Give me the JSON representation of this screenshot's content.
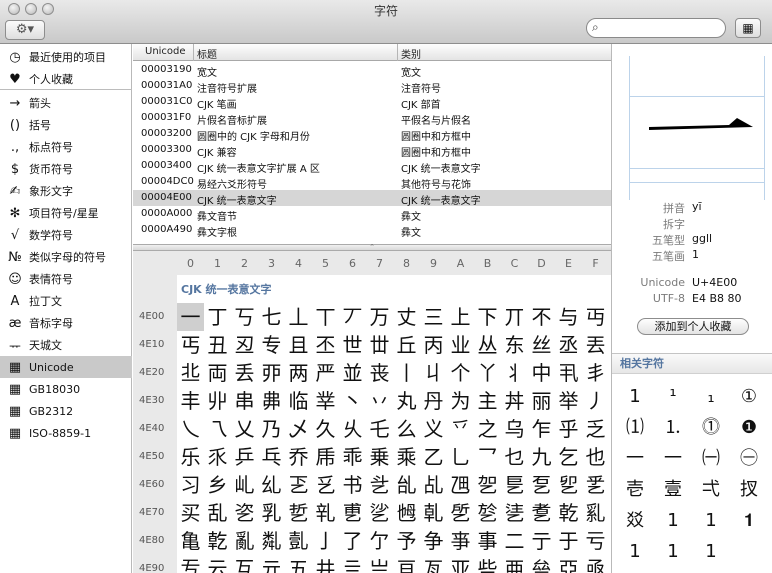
{
  "window": {
    "title": "字符"
  },
  "toolbar": {
    "gear": "⚙▾",
    "search_placeholder": "",
    "right_icon": "▦"
  },
  "sidebar": {
    "items": [
      {
        "icon": "◷",
        "label": "最近使用的项目"
      },
      {
        "icon": "♥",
        "label": "个人收藏"
      },
      {
        "icon": "→",
        "label": "箭头"
      },
      {
        "icon": "()",
        "label": "括号"
      },
      {
        "icon": ".,",
        "label": "标点符号"
      },
      {
        "icon": "$",
        "label": "货币符号"
      },
      {
        "icon": "✍",
        "label": "象形文字"
      },
      {
        "icon": "✻",
        "label": "项目符号/星星"
      },
      {
        "icon": "√",
        "label": "数学符号"
      },
      {
        "icon": "№",
        "label": "类似字母的符号"
      },
      {
        "icon": "☺",
        "label": "表情符号"
      },
      {
        "icon": "A",
        "label": "拉丁文"
      },
      {
        "icon": "æ",
        "label": "音标字母"
      },
      {
        "icon": "ᅲ",
        "label": "天城文"
      },
      {
        "icon": "▦",
        "label": "Unicode",
        "selected": true
      },
      {
        "icon": "▦",
        "label": "GB18030"
      },
      {
        "icon": "▦",
        "label": "GB2312"
      },
      {
        "icon": "▦",
        "label": "ISO-8859-1"
      }
    ]
  },
  "table": {
    "headers": [
      "Unicode",
      "标题",
      "类别"
    ],
    "rows": [
      [
        "00003190",
        "宽文",
        "宽文"
      ],
      [
        "000031A0",
        "注音符号扩展",
        "注音符号"
      ],
      [
        "000031C0",
        "CJK 笔画",
        "CJK 部首"
      ],
      [
        "000031F0",
        "片假名音标扩展",
        "平假名与片假名"
      ],
      [
        "00003200",
        "圆圈中的 CJK 字母和月份",
        "圆圈中和方框中"
      ],
      [
        "00003300",
        "CJK 兼容",
        "圆圈中和方框中"
      ],
      [
        "00003400",
        "CJK 统一表意文字扩展 A 区",
        "CJK 统一表意文字"
      ],
      [
        "00004DC0",
        "易经六爻形符号",
        "其他符号与花饰"
      ],
      [
        "00004E00",
        "CJK 统一表意文字",
        "CJK 统一表意文字"
      ],
      [
        "0000A000",
        "彝文音节",
        "彝文"
      ],
      [
        "0000A490",
        "彝文字根",
        "彝文"
      ]
    ],
    "selected_row": 8
  },
  "grid": {
    "block_name": "CJK 统一表意文字",
    "columns": [
      "0",
      "1",
      "2",
      "3",
      "4",
      "5",
      "6",
      "7",
      "8",
      "9",
      "A",
      "B",
      "C",
      "D",
      "E",
      "F"
    ],
    "rows": [
      {
        "label": "4E00",
        "chars": [
          "一",
          "丁",
          "丂",
          "七",
          "丄",
          "丅",
          "丆",
          "万",
          "丈",
          "三",
          "上",
          "下",
          "丌",
          "不",
          "与",
          "丏"
        ]
      },
      {
        "label": "4E10",
        "chars": [
          "丐",
          "丑",
          "丒",
          "专",
          "且",
          "丕",
          "世",
          "丗",
          "丘",
          "丙",
          "业",
          "丛",
          "东",
          "丝",
          "丞",
          "丟"
        ]
      },
      {
        "label": "4E20",
        "chars": [
          "丠",
          "両",
          "丢",
          "丣",
          "两",
          "严",
          "並",
          "丧",
          "丨",
          "丩",
          "个",
          "丫",
          "丬",
          "中",
          "丮",
          "丯"
        ]
      },
      {
        "label": "4E30",
        "chars": [
          "丰",
          "丱",
          "串",
          "丳",
          "临",
          "丵",
          "丶",
          "丷",
          "丸",
          "丹",
          "为",
          "主",
          "丼",
          "丽",
          "举",
          "丿"
        ]
      },
      {
        "label": "4E40",
        "chars": [
          "乀",
          "乁",
          "乂",
          "乃",
          "乄",
          "久",
          "乆",
          "乇",
          "么",
          "义",
          "乊",
          "之",
          "乌",
          "乍",
          "乎",
          "乏"
        ]
      },
      {
        "label": "4E50",
        "chars": [
          "乐",
          "乑",
          "乒",
          "乓",
          "乔",
          "乕",
          "乖",
          "乗",
          "乘",
          "乙",
          "乚",
          "乛",
          "乜",
          "九",
          "乞",
          "也"
        ]
      },
      {
        "label": "4E60",
        "chars": [
          "习",
          "乡",
          "乢",
          "乣",
          "乤",
          "乥",
          "书",
          "乧",
          "乨",
          "乩",
          "乪",
          "乫",
          "乬",
          "乭",
          "乮",
          "乯"
        ]
      },
      {
        "label": "4E70",
        "chars": [
          "买",
          "乱",
          "乲",
          "乳",
          "乴",
          "乵",
          "乶",
          "乷",
          "乸",
          "乹",
          "乺",
          "乻",
          "乼",
          "乽",
          "乾",
          "乿"
        ]
      },
      {
        "label": "4E80",
        "chars": [
          "亀",
          "亁",
          "亂",
          "亃",
          "亄",
          "亅",
          "了",
          "亇",
          "予",
          "争",
          "亊",
          "事",
          "二",
          "亍",
          "于",
          "亏"
        ]
      },
      {
        "label": "4E90",
        "chars": [
          "亐",
          "云",
          "互",
          "亓",
          "五",
          "井",
          "亖",
          "亗",
          "亘",
          "亙",
          "亚",
          "些",
          "亜",
          "亝",
          "亞",
          "亟"
        ]
      }
    ]
  },
  "inspector": {
    "glyph": "一",
    "info": [
      {
        "key": "拼音",
        "value": "yī"
      },
      {
        "key": "拆字",
        "value": ""
      },
      {
        "key": "五笔型",
        "value": "ggll"
      },
      {
        "key": "五笔画",
        "value": "1"
      },
      {
        "key": "Unicode",
        "value": "U+4E00"
      },
      {
        "key": "UTF-8",
        "value": "E4 B8 80"
      }
    ],
    "add_favorite": "添加到个人收藏",
    "related_title": "相关字符",
    "related": [
      "1",
      "¹",
      "₁",
      "①",
      "⑴",
      "⒈",
      "⓵",
      "❶",
      "一",
      "一",
      "㈠",
      "㊀",
      "壱",
      "壹",
      "弌",
      "扠",
      "㸚",
      "1",
      "1",
      "𝟏",
      "1",
      "1",
      "1"
    ]
  }
}
